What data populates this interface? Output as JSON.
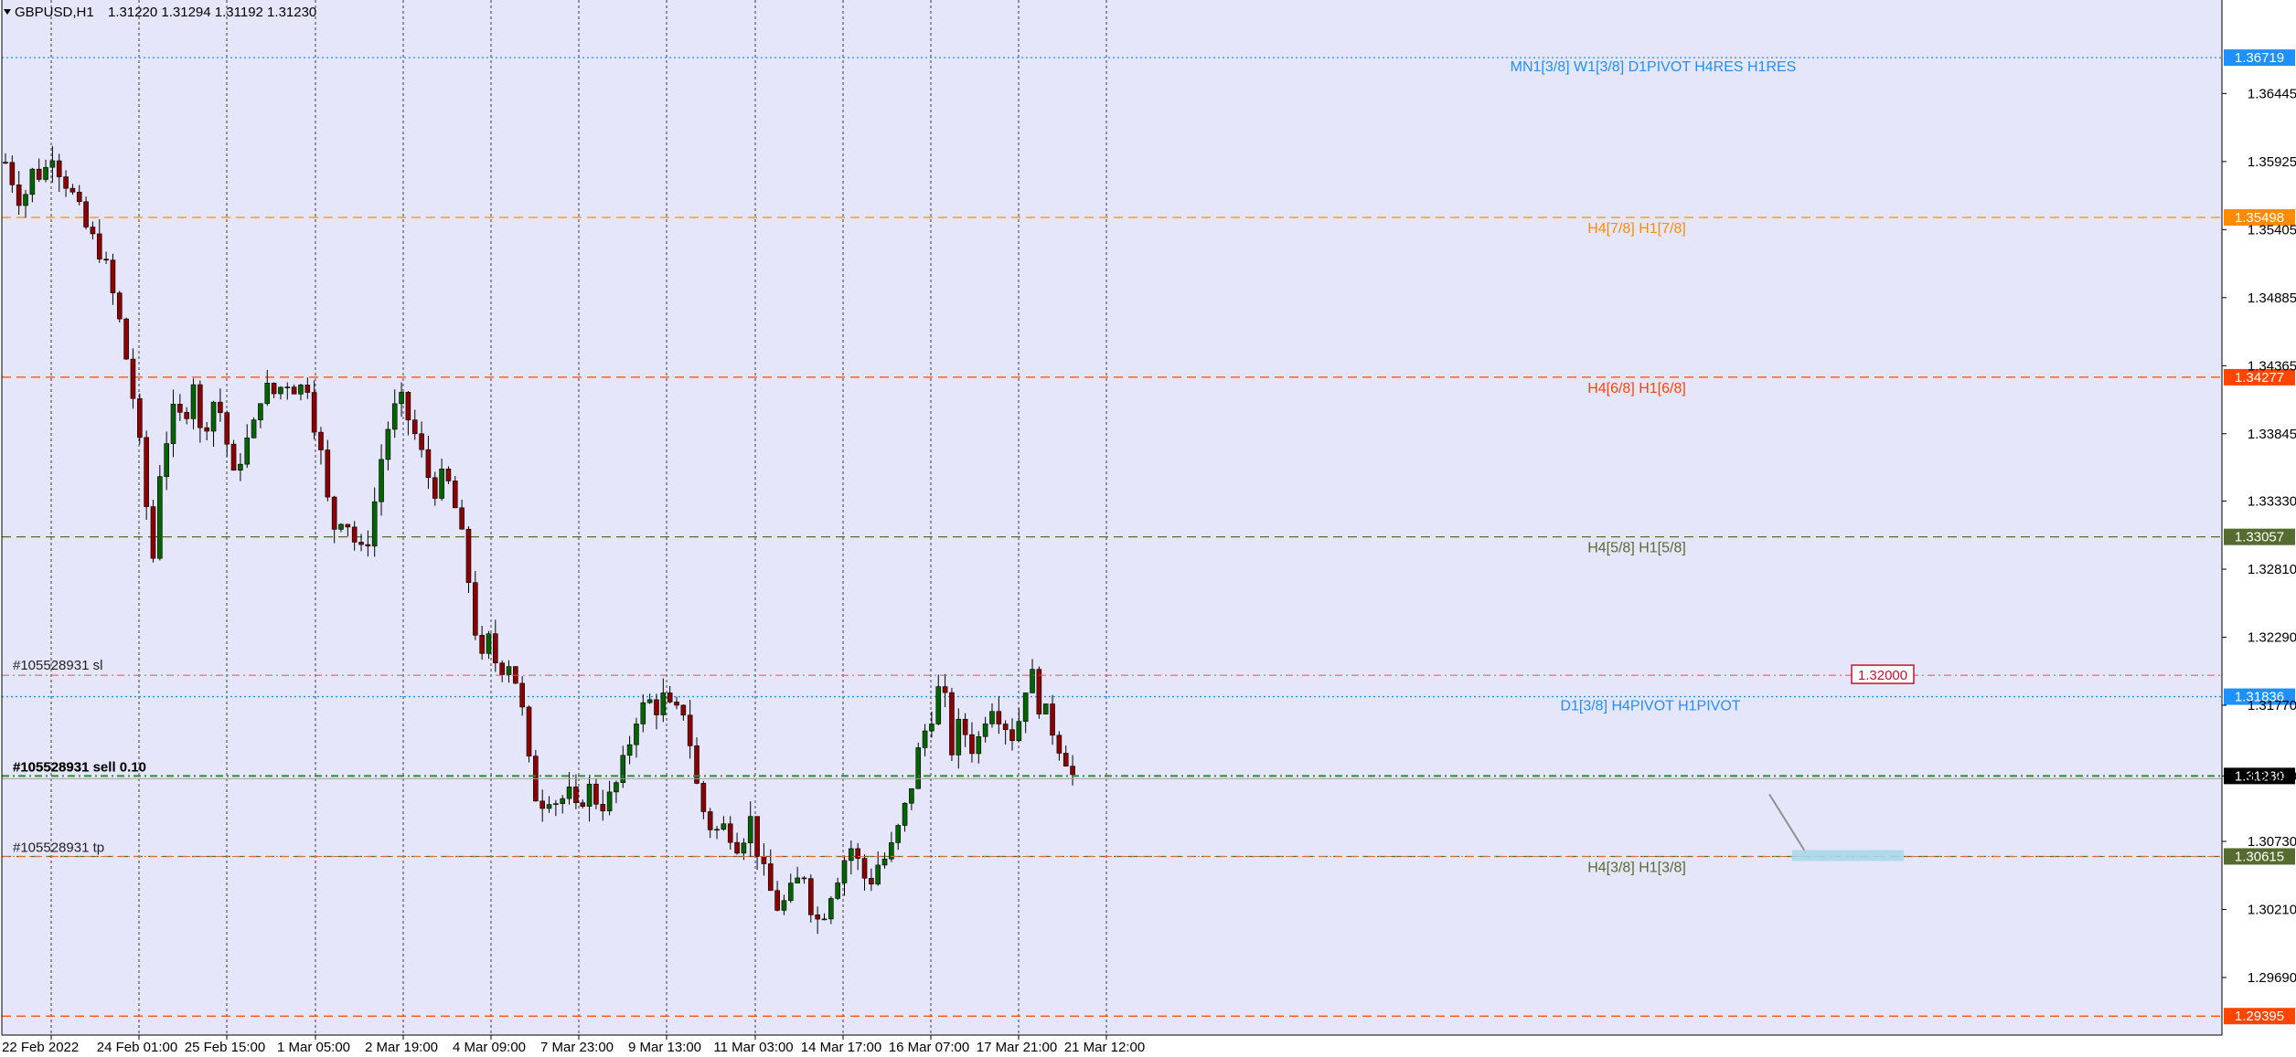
{
  "header": {
    "symbol_timeframe": "GBPUSD,H1",
    "ohlc": "1.31220 1.31294 1.31192 1.31230"
  },
  "colors": {
    "background": "#e6e6fa",
    "bull": "#006400",
    "bear": "#8b0000",
    "wick": "#000000",
    "grid": "#000000",
    "level_blue": "#1e90ff",
    "level_orange": "#ff8c00",
    "level_red": "#ff4500",
    "level_olive": "#556b2f",
    "level_darkred": "#c8102e",
    "level_green": "#228b22",
    "bid_box": "#000000"
  },
  "chart_data": {
    "type": "candlestick",
    "symbol": "GBPUSD",
    "timeframe": "H1",
    "ylim": [
      1.2925,
      1.3695
    ],
    "y_ticks": [
      "1.36445",
      "1.35925",
      "1.35405",
      "1.34885",
      "1.34365",
      "1.33845",
      "1.33330",
      "1.32810",
      "1.32290",
      "1.31770",
      "1.31230",
      "1.30730",
      "1.30210",
      "1.29690"
    ],
    "x_ticks": [
      "22 Feb 2022",
      "24 Feb 01:00",
      "25 Feb 15:00",
      "1 Mar 05:00",
      "2 Mar 19:00",
      "4 Mar 09:00",
      "7 Mar 23:00",
      "9 Mar 13:00",
      "11 Mar 03:00",
      "14 Mar 17:00",
      "16 Mar 07:00",
      "17 Mar 21:00",
      "21 Mar 12:00"
    ],
    "price_path": [
      [
        0,
        1.3592
      ],
      [
        4,
        1.356
      ],
      [
        7,
        1.3588
      ],
      [
        9,
        1.358
      ],
      [
        12,
        1.3604
      ],
      [
        13,
        1.3588
      ],
      [
        16,
        1.357
      ],
      [
        20,
        1.354
      ],
      [
        24,
        1.352
      ],
      [
        28,
        1.347
      ],
      [
        31,
        1.342
      ],
      [
        34,
        1.335
      ],
      [
        36,
        1.328
      ],
      [
        38,
        1.336
      ],
      [
        41,
        1.34
      ],
      [
        44,
        1.3395
      ],
      [
        46,
        1.343
      ],
      [
        48,
        1.338
      ],
      [
        51,
        1.341
      ],
      [
        53,
        1.34
      ],
      [
        56,
        1.335
      ],
      [
        58,
        1.337
      ],
      [
        61,
        1.339
      ],
      [
        63,
        1.342
      ],
      [
        66,
        1.3415
      ],
      [
        69,
        1.3425
      ],
      [
        72,
        1.3418
      ],
      [
        74,
        1.3425
      ],
      [
        76,
        1.339
      ],
      [
        78,
        1.336
      ],
      [
        80,
        1.331
      ],
      [
        83,
        1.3325
      ],
      [
        86,
        1.33
      ],
      [
        88,
        1.329
      ],
      [
        90,
        1.332
      ],
      [
        93,
        1.338
      ],
      [
        95,
        1.34
      ],
      [
        97,
        1.341
      ],
      [
        99,
        1.3395
      ],
      [
        101,
        1.338
      ],
      [
        103,
        1.336
      ],
      [
        105,
        1.334
      ],
      [
        107,
        1.335
      ],
      [
        109,
        1.3345
      ],
      [
        111,
        1.332
      ],
      [
        113,
        1.329
      ],
      [
        115,
        1.324
      ],
      [
        117,
        1.321
      ],
      [
        119,
        1.323
      ],
      [
        121,
        1.32
      ],
      [
        123,
        1.3215
      ],
      [
        125,
        1.32
      ],
      [
        127,
        1.317
      ],
      [
        129,
        1.312
      ],
      [
        131,
        1.31
      ],
      [
        133,
        1.311
      ],
      [
        136,
        1.3102
      ],
      [
        138,
        1.3112
      ],
      [
        140,
        1.3095
      ],
      [
        143,
        1.3115
      ],
      [
        146,
        1.31
      ],
      [
        149,
        1.3108
      ],
      [
        152,
        1.3135
      ],
      [
        155,
        1.317
      ],
      [
        158,
        1.318
      ],
      [
        160,
        1.3175
      ],
      [
        162,
        1.3185
      ],
      [
        164,
        1.3165
      ],
      [
        166,
        1.318
      ],
      [
        168,
        1.315
      ],
      [
        170,
        1.311
      ],
      [
        172,
        1.309
      ],
      [
        174,
        1.308
      ],
      [
        177,
        1.3085
      ],
      [
        180,
        1.307
      ],
      [
        183,
        1.309
      ],
      [
        185,
        1.306
      ],
      [
        187,
        1.304
      ],
      [
        190,
        1.302
      ],
      [
        193,
        1.3035
      ],
      [
        196,
        1.305
      ],
      [
        198,
        1.302
      ],
      [
        200,
        1.301
      ],
      [
        202,
        1.303
      ],
      [
        204,
        1.3045
      ],
      [
        206,
        1.306
      ],
      [
        208,
        1.307
      ],
      [
        210,
        1.305
      ],
      [
        212,
        1.304
      ],
      [
        214,
        1.3055
      ],
      [
        216,
        1.306
      ],
      [
        218,
        1.307
      ],
      [
        220,
        1.309
      ],
      [
        222,
        1.311
      ],
      [
        224,
        1.314
      ],
      [
        226,
        1.316
      ],
      [
        228,
        1.3175
      ],
      [
        230,
        1.32
      ],
      [
        232,
        1.314
      ],
      [
        234,
        1.316
      ],
      [
        236,
        1.3155
      ],
      [
        238,
        1.314
      ],
      [
        240,
        1.3165
      ],
      [
        242,
        1.318
      ],
      [
        244,
        1.317
      ],
      [
        246,
        1.316
      ],
      [
        248,
        1.315
      ],
      [
        250,
        1.319
      ],
      [
        252,
        1.32
      ],
      [
        254,
        1.3175
      ],
      [
        256,
        1.3168
      ],
      [
        258,
        1.315
      ],
      [
        260,
        1.314
      ],
      [
        262,
        1.3123
      ]
    ],
    "levels": [
      {
        "price": 1.36719,
        "label": "1.36719",
        "color": "#1e90ff",
        "style": "dot",
        "text": "MN1[3/8] W1[3/8] D1PIVOT H4RES H1RES"
      },
      {
        "price": 1.35498,
        "label": "1.35498",
        "color": "#ff8c00",
        "style": "dash",
        "text": "H4[7/8] H1[7/8]"
      },
      {
        "price": 1.34277,
        "label": "1.34277",
        "color": "#ff4500",
        "style": "dash",
        "text": "H4[6/8] H1[6/8]"
      },
      {
        "price": 1.33057,
        "label": "1.33057",
        "color": "#556b2f",
        "style": "dash",
        "text": "H4[5/8] H1[5/8]"
      },
      {
        "price": 1.31836,
        "label": "1.31836",
        "color": "#1e90ff",
        "style": "dot",
        "text": "D1[3/8] H4PIVOT H1PIVOT"
      },
      {
        "price": 1.30615,
        "label": "1.30615",
        "color": "#556b2f",
        "style": "dash",
        "text": "H4[3/8] H1[3/8]"
      },
      {
        "price": 1.29395,
        "label": "1.29395",
        "color": "#ff4500",
        "style": "dash",
        "text": ""
      }
    ],
    "orders": {
      "sl_label": "#105528931 sl",
      "sl_price": 1.32,
      "sl_price_label": "1.32000",
      "open_label": "#105528931 sell 0.10",
      "open_label_overlay": "#105528931",
      "open_price": 1.3123,
      "tp_label": "#105528931 tp",
      "tp_price": 1.30615,
      "current_price_label": "1.31230"
    }
  }
}
